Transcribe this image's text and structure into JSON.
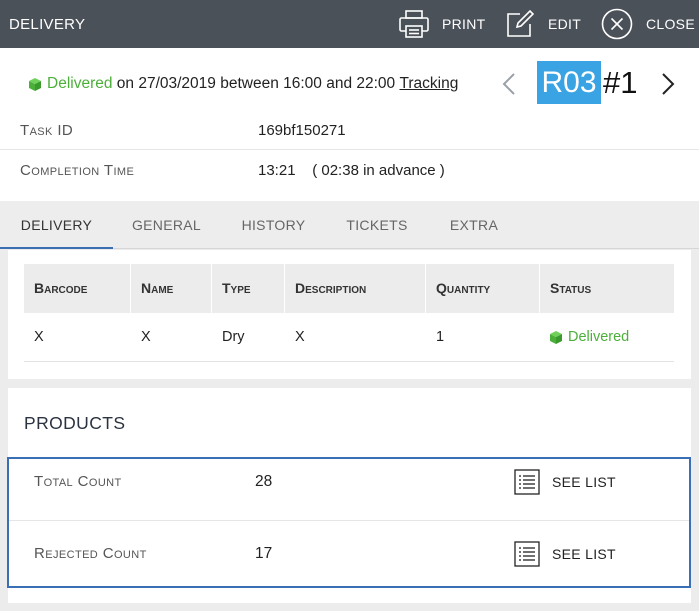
{
  "topbar": {
    "title": "DELIVERY",
    "print_label": "PRINT",
    "edit_label": "EDIT",
    "close_label": "CLOSE"
  },
  "status": {
    "state": "Delivered",
    "date_text": " on 27/03/2019 between 16:00 and 22:00 ",
    "tracking_label": "Tracking",
    "color": "#4caf3a"
  },
  "route": {
    "code": "R03",
    "number": "#1",
    "badge_color": "#3aa3e3"
  },
  "info": {
    "task_id_label": "Task ID",
    "task_id_value": "169bf150271",
    "completion_label": "Completion Time",
    "completion_value": "13:21    ( 02:38 in advance )"
  },
  "tabs": [
    "DELIVERY",
    "GENERAL",
    "HISTORY",
    "TICKETS",
    "EXTRA"
  ],
  "table": {
    "headers": [
      "Barcode",
      "Name",
      "Type",
      "Description",
      "Quantity",
      "Status"
    ],
    "rows": [
      [
        "X",
        "X",
        "Dry",
        "X",
        "1",
        "Delivered"
      ]
    ]
  },
  "products": {
    "title": "PRODUCTS",
    "total_label": "Total Count",
    "total_value": "28",
    "rejected_label": "Rejected Count",
    "rejected_value": "17",
    "see_list_label": "SEE LIST"
  },
  "colors": {
    "topbar": "#4b5159",
    "accent": "#3a6fb5"
  }
}
